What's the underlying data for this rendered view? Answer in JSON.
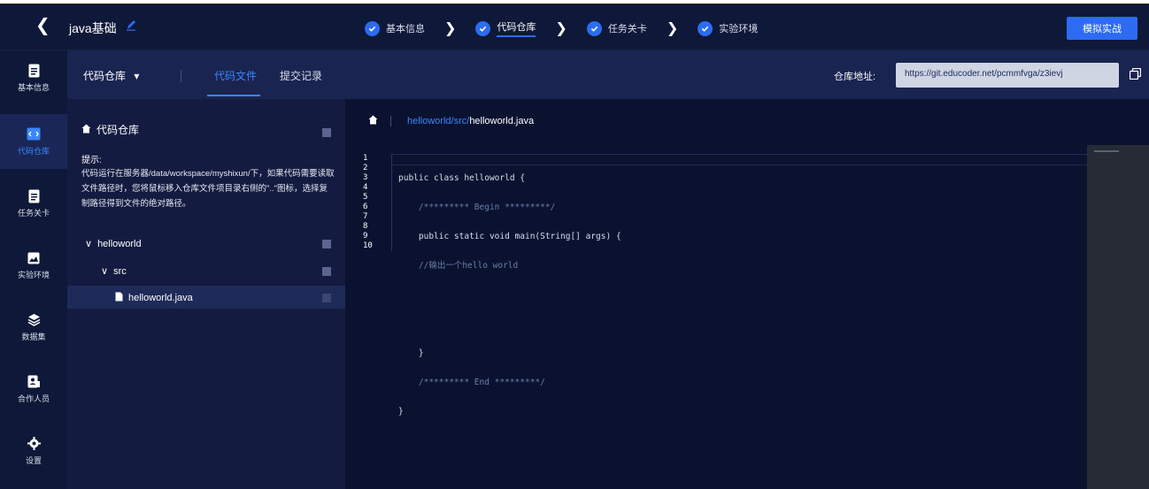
{
  "header": {
    "back_glyph": "❮",
    "title": "java基础",
    "steps": [
      {
        "label": "基本信息",
        "active": false
      },
      {
        "label": "代码仓库",
        "active": true
      },
      {
        "label": "任务关卡",
        "active": false
      },
      {
        "label": "实验环境",
        "active": false
      }
    ],
    "step_separator": "❯",
    "publish_label": "模拟实战"
  },
  "sidebar": {
    "items": [
      {
        "label": "基本信息",
        "icon": "document-icon",
        "active": false
      },
      {
        "label": "代码仓库",
        "icon": "repo-icon",
        "active": true
      },
      {
        "label": "任务关卡",
        "icon": "document-icon",
        "active": false
      },
      {
        "label": "实验环境",
        "icon": "image-icon",
        "active": false
      },
      {
        "label": "数据集",
        "icon": "layers-icon",
        "active": false
      },
      {
        "label": "合作人员",
        "icon": "user-card-icon",
        "active": false
      },
      {
        "label": "设置",
        "icon": "gear-icon",
        "active": false
      }
    ]
  },
  "toolbar": {
    "repo_select": "代码仓库",
    "dropdown_glyph": "▾",
    "tabs": [
      {
        "label": "代码文件",
        "active": true
      },
      {
        "label": "提交记录",
        "active": false
      }
    ],
    "address_label": "仓库地址:",
    "address_value": "https://git.educoder.net/pcmmfvga/z3ievj"
  },
  "tree": {
    "root_label": "代码仓库",
    "hint_title": "提示:",
    "hint_body": "代码运行在服务器/data/workspace/myshixun/下，如果代码需要读取文件路径时，您将鼠标移入仓库文件项目录右侧的\"..\"图标，选择复制路径得到文件的绝对路径。",
    "nodes": [
      {
        "label": "helloworld",
        "arrow": "∨"
      },
      {
        "label": "src",
        "arrow": "∨"
      },
      {
        "label": "helloworld.java"
      }
    ]
  },
  "editor": {
    "breadcrumb_prefix": "helloworld/src/",
    "breadcrumb_file": "helloworld.java",
    "line_numbers": [
      "1",
      "2",
      "3",
      "4",
      "5",
      "6",
      "7",
      "8",
      "9",
      "10"
    ],
    "code_lines": [
      "public class helloworld {",
      "    /********* Begin *********/",
      "    public static void main(String[] args) {",
      "    //输出一个hello world",
      "",
      "",
      "    }",
      "    /********* End *********/",
      "}",
      ""
    ]
  },
  "colors": {
    "accent": "#2c6bf2",
    "link": "#3a86ff",
    "background": "#0b1430",
    "panel": "#131c40"
  }
}
